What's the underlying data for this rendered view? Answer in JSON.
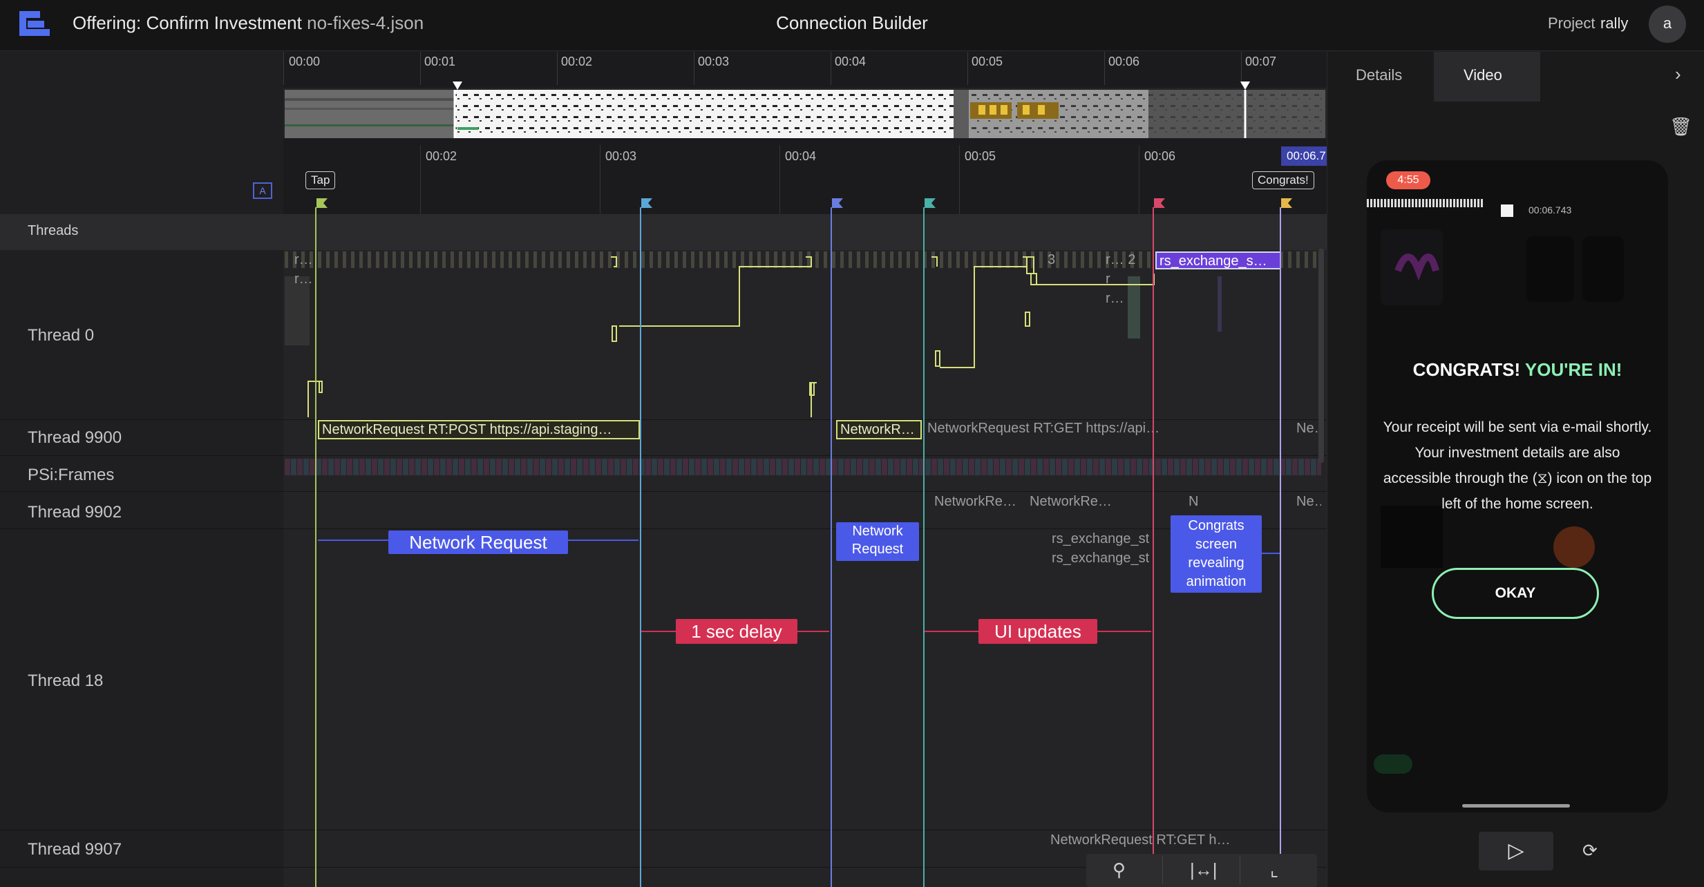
{
  "header": {
    "title_prefix": "Offering: Confirm Investment",
    "file_name": "no-fixes-4.json",
    "center_title": "Connection Builder",
    "project_label": "Project",
    "project_name": "rally",
    "avatar_initial": "a"
  },
  "ruler_top": [
    "00:00",
    "00:01",
    "00:02",
    "00:03",
    "00:04",
    "00:05",
    "00:06",
    "00:07"
  ],
  "ruler_zoom": [
    "00:02",
    "00:03",
    "00:04",
    "00:05",
    "00:06"
  ],
  "current_time": "00:06.7",
  "markers": {
    "tap": "Tap",
    "congrats": "Congrats!"
  },
  "threads_header": "Threads",
  "rows": {
    "thread0": "Thread 0",
    "thread9900": "Thread 9900",
    "psi": "PSi:Frames",
    "thread9902": "Thread 9902",
    "thread18": "Thread 18",
    "thread9907": "Thread 9907"
  },
  "slices": {
    "t0_r1": "r…",
    "t0_r2": "r…",
    "t0_n3": "3",
    "t0_r2b": "r… 2",
    "t0_r": "r",
    "t0_r3": "r…",
    "t0_rs": "rs_exchange_s…",
    "t9900_a": "NetworkRequest RT:POST https://api.staging…",
    "t9900_b": "NetworkR…",
    "t9900_c": "NetworkRequest RT:GET https://api…",
    "t9900_d": "Ne…",
    "t9902_a": "NetworkRe…",
    "t9902_b": "NetworkRe…",
    "t9902_c": "N",
    "t9902_d": "Ne…",
    "t18_a": "rs_exchange_st",
    "t18_b": "rs_exchange_st",
    "t9907_a": "NetworkRequest RT:GET h…"
  },
  "annotations": {
    "network_request_1": "Network Request",
    "network_request_2": "Network Request",
    "delay": "1 sec delay",
    "ui_updates": "UI updates",
    "congrats_anim": "Congrats screen revealing animation"
  },
  "right_panel": {
    "tab_details": "Details",
    "tab_video": "Video"
  },
  "phone": {
    "status_time": "4:55",
    "timestamp": "00:06.743",
    "title_white": "CONGRATS!",
    "title_accent": "YOU'RE IN!",
    "body": "Your receipt will be sent via e-mail shortly. Your investment details are also accessible through the (⧖) icon on the top left of the home screen.",
    "button": "OKAY"
  },
  "colors": {
    "accent_blue": "#4b59e8",
    "accent_red": "#d43052",
    "slice_yellow": "#d8e07a",
    "accent_green": "#8ef0b4",
    "slice_purple": "#6a3fd8"
  }
}
